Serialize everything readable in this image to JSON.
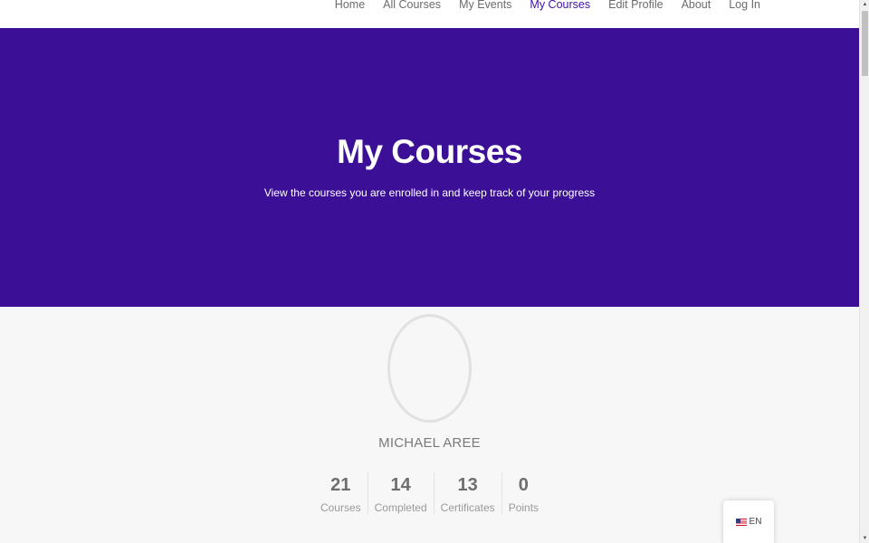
{
  "nav": {
    "items": [
      {
        "label": "Home"
      },
      {
        "label": "All Courses"
      },
      {
        "label": "My Events"
      },
      {
        "label": "My Courses",
        "active": true
      },
      {
        "label": "Edit Profile"
      },
      {
        "label": "About"
      },
      {
        "label": "Log In"
      }
    ]
  },
  "hero": {
    "title": "My Courses",
    "subtitle": "View the courses you are enrolled in and keep track of your progress",
    "background_color": "#3c1096"
  },
  "profile": {
    "name": "MICHAEL AREE",
    "stats": [
      {
        "value": "21",
        "label": "Courses"
      },
      {
        "value": "14",
        "label": "Completed"
      },
      {
        "value": "13",
        "label": "Certificates"
      },
      {
        "value": "0",
        "label": "Points"
      }
    ]
  },
  "language": {
    "code": "EN",
    "flag_icon": "us-flag-icon"
  },
  "colors": {
    "accent": "#3f13a4"
  }
}
